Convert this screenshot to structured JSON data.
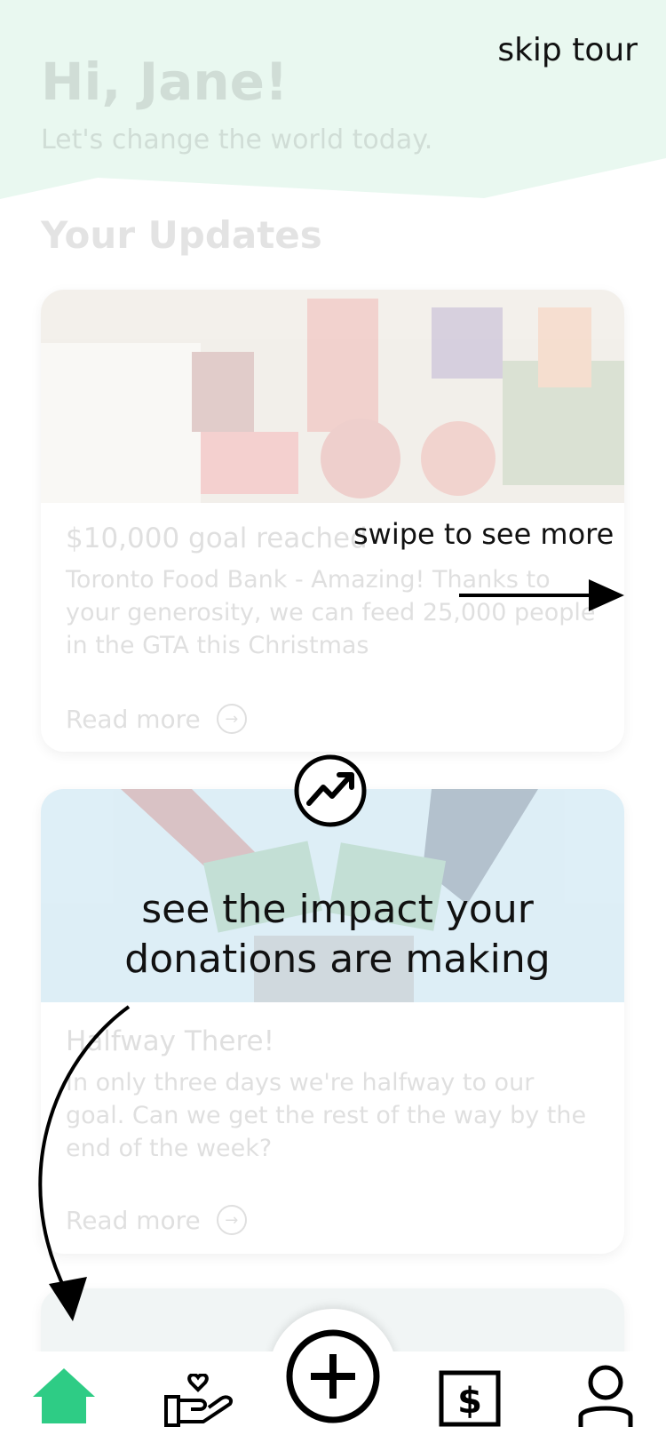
{
  "header": {
    "greeting": "Hi, Jane!",
    "subtitle": "Let's change the world today.",
    "skip_label": "skip tour"
  },
  "updates": {
    "section_title": "Your Updates",
    "cards": [
      {
        "title": "$10,000 goal reached",
        "body": "Toronto Food Bank - Amazing! Thanks to your generosity, we can feed 25,000 people in the GTA this Christmas",
        "read_more": "Read more",
        "image": "food-donations-photo"
      },
      {
        "title": "Halfway There!",
        "body": "In only three days we're halfway to our goal. Can we get the rest of the way by the end of the week?",
        "read_more": "Read more",
        "image": "hands-holding-money-illustration"
      }
    ]
  },
  "tour": {
    "swipe_hint": "swipe to see more",
    "impact_hint": "see the impact your donations are making",
    "impact_icon": "trending-up-icon"
  },
  "nav": {
    "items": [
      "home-icon",
      "give-heart-icon",
      "add-icon",
      "dollar-icon",
      "profile-icon"
    ],
    "active": "home-icon",
    "active_color": "#2ecc85"
  }
}
